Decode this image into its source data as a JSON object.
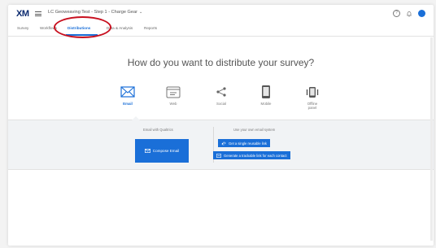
{
  "app": {
    "logo": "XM",
    "project_title": "LC Geoweaving Test - Step 1 - Charge Gear",
    "title_chevron": "⌄"
  },
  "top_icons": {
    "help": "?",
    "notifications": "🔔"
  },
  "tabs": [
    {
      "label": "Survey",
      "active": false
    },
    {
      "label": "Workflows",
      "active": false
    },
    {
      "label": "Distributions",
      "active": true
    },
    {
      "label": "Data & Analysis",
      "active": false
    },
    {
      "label": "Reports",
      "active": false
    }
  ],
  "headline": "How do you want to distribute your survey?",
  "options": [
    {
      "label": "Email",
      "icon": "envelope-icon",
      "selected": true
    },
    {
      "label": "Web",
      "icon": "browser-icon",
      "selected": false
    },
    {
      "label": "Social",
      "icon": "share-icon",
      "selected": false
    },
    {
      "label": "Mobile",
      "icon": "mobile-icon",
      "selected": false
    },
    {
      "label": "Offline\npanel",
      "icon": "offline-app-icon",
      "selected": false
    }
  ],
  "email_panel": {
    "left_label": "Email with Qualtrics",
    "compose_label": "Compose Email",
    "right_label": "Use your own email system",
    "single_link_label": "Get a single reusable link",
    "multi_link_label": "Generate a trackable link for each contact"
  },
  "colors": {
    "accent": "#1a6fd8",
    "highlight": "#c8101f"
  }
}
